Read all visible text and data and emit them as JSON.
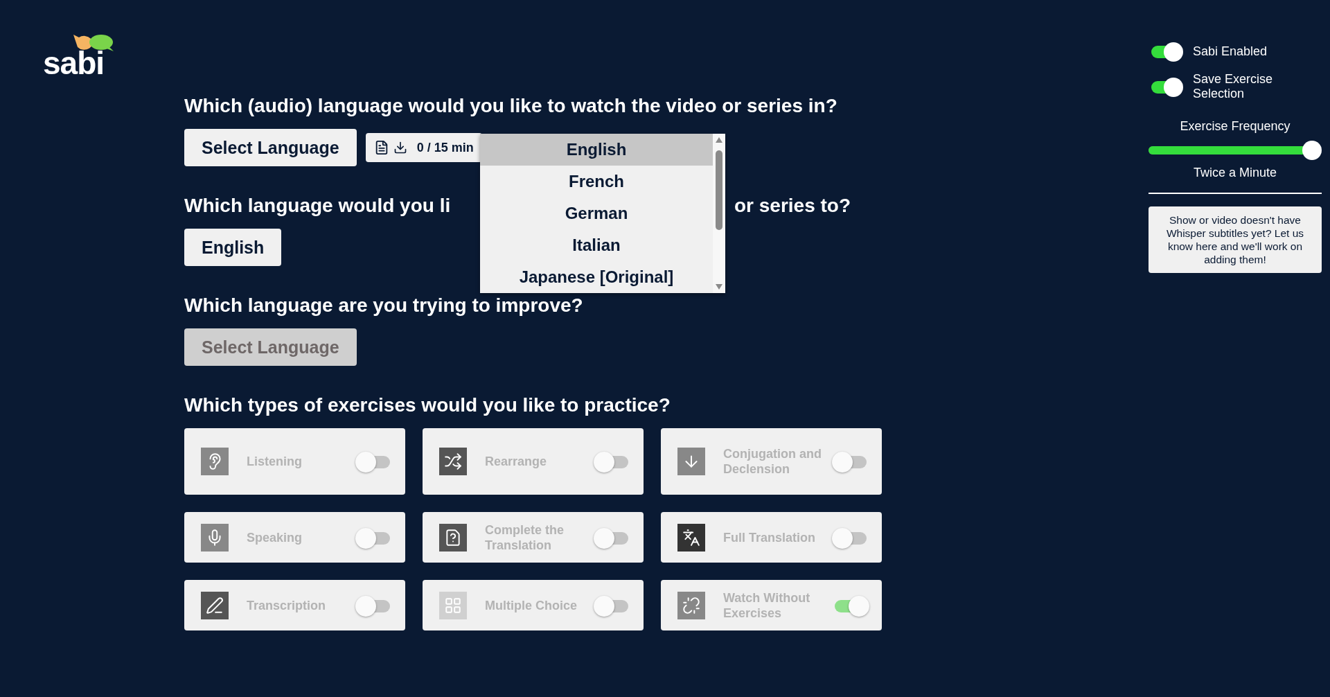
{
  "logo": {
    "text": "sabi"
  },
  "questions": [
    {
      "kind": "picker",
      "heading": "Which (audio) language would you like to watch the video or series in?",
      "button": {
        "label": "Select Language",
        "disabled": false
      },
      "chip": "0 / 15 min"
    },
    {
      "kind": "covered",
      "heading_left": "Which language would you li",
      "heading_right": "or series to?",
      "button": {
        "label": "English",
        "disabled": false
      }
    },
    {
      "kind": "plain",
      "heading": "Which language are you trying to improve?",
      "button": {
        "label": "Select Language",
        "disabled": true
      }
    }
  ],
  "dropdown": {
    "options": [
      {
        "label": "English",
        "selected": true
      },
      {
        "label": "French",
        "selected": false
      },
      {
        "label": "German",
        "selected": false
      },
      {
        "label": "Italian",
        "selected": false
      },
      {
        "label": "Japanese [Original]",
        "selected": false
      }
    ]
  },
  "exercises_heading": "Which types of exercises would you like to practice?",
  "exercises": [
    {
      "kind": "ear",
      "label": "Listening",
      "on": false
    },
    {
      "kind": "rearrange",
      "label": "Rearrange",
      "on": false
    },
    {
      "kind": "conjugation",
      "label": "Conjugation and Declension",
      "on": false
    },
    {
      "kind": "mic",
      "label": "Speaking",
      "on": false
    },
    {
      "kind": "question",
      "label": "Complete the Translation",
      "on": false
    },
    {
      "kind": "translate",
      "label": "Full Translation",
      "on": false
    },
    {
      "kind": "pen",
      "label": "Transcription",
      "on": false
    },
    {
      "kind": "grid",
      "label": "Multiple Choice",
      "on": false
    },
    {
      "kind": "unlink",
      "label": "Watch Without Exercises",
      "on": true
    }
  ],
  "settings": {
    "toggles": [
      {
        "label": "Sabi Enabled",
        "on": true
      },
      {
        "label": "Save Exercise Selection",
        "on": true
      }
    ],
    "frequency": {
      "title": "Exercise Frequency",
      "level": 1,
      "reading": "Twice a Minute"
    },
    "feedback": "Show or video doesn't have Whisper subtitles yet? Let us know here and we'll work on adding them!"
  }
}
